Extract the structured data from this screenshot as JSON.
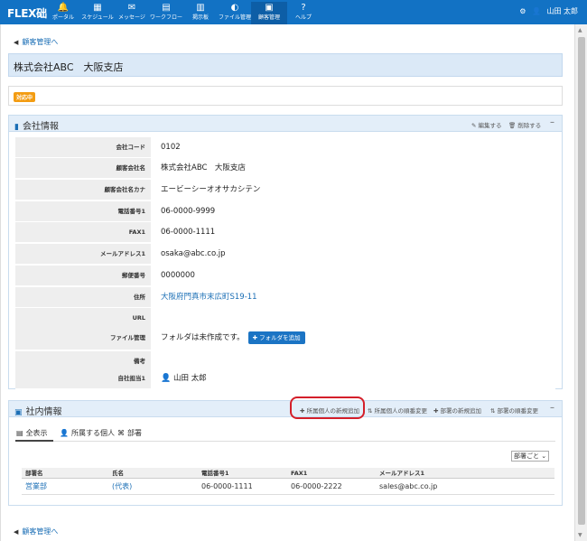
{
  "app": {
    "brand": "FLEX础",
    "nav": [
      {
        "label": "ポータル",
        "icon": "bell-icon",
        "glyph": "🔔"
      },
      {
        "label": "スケジュール",
        "icon": "calendar-icon",
        "glyph": "▦"
      },
      {
        "label": "メッセージ",
        "icon": "envelope-icon",
        "glyph": "✉"
      },
      {
        "label": "ワークフロー",
        "icon": "workflow-icon",
        "glyph": "▤"
      },
      {
        "label": "掲示板",
        "icon": "board-icon",
        "glyph": "▥"
      },
      {
        "label": "ファイル管理",
        "icon": "folder-icon",
        "glyph": "◐"
      },
      {
        "label": "顧客管理",
        "icon": "customer-icon",
        "glyph": "▣"
      },
      {
        "label": "ヘルプ",
        "icon": "help-icon",
        "glyph": "?"
      }
    ],
    "user": {
      "name": "山田 太郎",
      "settings_icon": "gear-icon",
      "user_icon": "user-icon"
    }
  },
  "back_link": "顧客管理へ",
  "page_title": "株式会社ABC　大阪支店",
  "status_badge": "対応中",
  "company_panel": {
    "title": "会社情報",
    "actions": {
      "edit": "編集する",
      "delete": "削除する"
    },
    "fields": [
      {
        "label": "会社コード",
        "value": "0102"
      },
      {
        "label": "顧客会社名",
        "value": "株式会社ABC　大阪支店"
      },
      {
        "label": "顧客会社名カナ",
        "value": "エービーシーオオサカシテン"
      },
      {
        "label": "電話番号1",
        "value": "06-0000-9999"
      },
      {
        "label": "FAX1",
        "value": "06-0000-1111"
      },
      {
        "label": "メールアドレス1",
        "value": "osaka@abc.co.jp"
      },
      {
        "label": "郵便番号",
        "value": "0000000"
      },
      {
        "label": "住所",
        "value": "大阪府門真市末広町S19-11"
      },
      {
        "label": "URL",
        "value": ""
      },
      {
        "label": "ファイル管理",
        "value": "フォルダは未作成です。"
      },
      {
        "label": "備考",
        "value": ""
      },
      {
        "label": "自社担当1",
        "value": "山田 太郎"
      }
    ],
    "add_folder_button": "フォルダを追加"
  },
  "internal_panel": {
    "title": "社内情報",
    "actions": {
      "add_person": "所属個人の新規追加",
      "person_order": "所属個人の順番変更",
      "add_dept": "部署の新規追加",
      "dept_order": "部署の順番変更"
    },
    "tabs": [
      {
        "label": "全表示",
        "icon": "card-icon",
        "glyph": "▤"
      },
      {
        "label": "所属する個人",
        "icon": "person-icon",
        "glyph": "👤"
      },
      {
        "label": "部署",
        "icon": "sitemap-icon",
        "glyph": "⌘"
      }
    ],
    "sort_select": "部署ごと",
    "table": {
      "columns": [
        "部署名",
        "氏名",
        "電話番号1",
        "FAX1",
        "メールアドレス1"
      ],
      "rows": [
        {
          "dept": "営業部",
          "name": "(代表)",
          "tel": "06-0000-1111",
          "fax": "06-0000-2222",
          "email": "sales@abc.co.jp"
        }
      ]
    }
  }
}
